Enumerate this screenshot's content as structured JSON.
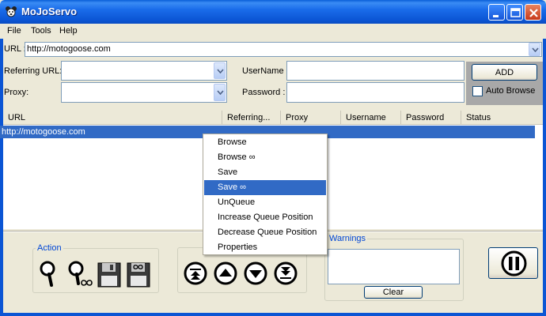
{
  "window": {
    "title": "MoJoServo"
  },
  "menu": [
    "File",
    "Tools",
    "Help"
  ],
  "url_field": {
    "label": "URL :",
    "value": "http://motogoose.com"
  },
  "referring_url": {
    "label": "Referring URL:",
    "value": ""
  },
  "proxy": {
    "label": "Proxy:",
    "value": ""
  },
  "username": {
    "label": "UserName :",
    "value": ""
  },
  "password": {
    "label": "Password :",
    "value": ""
  },
  "add_button": "ADD",
  "auto_browse": {
    "label": "Auto Browse",
    "checked": false
  },
  "table": {
    "columns": [
      "URL",
      "Referring...",
      "Proxy",
      "Username",
      "Password",
      "Status"
    ],
    "rows": [
      {
        "url": "http://motogoose.com",
        "referring": "",
        "proxy": "",
        "username": "",
        "password": "",
        "status": "",
        "selected": true
      }
    ]
  },
  "context_menu": {
    "items": [
      "Browse",
      "Browse ∞",
      "Save",
      "Save ∞",
      "UnQueue",
      "Increase Queue Position",
      "Decrease Queue Position",
      "Properties"
    ],
    "highlighted": "Save ∞"
  },
  "action_group": {
    "title": "Action",
    "buttons": [
      {
        "icon": "magnifier-icon"
      },
      {
        "icon": "magnifier-infinity-icon"
      },
      {
        "icon": "floppy-disk-icon"
      },
      {
        "icon": "floppy-disk-infinity-icon"
      }
    ]
  },
  "queue_group": {
    "buttons": [
      {
        "icon": "move-top-icon"
      },
      {
        "icon": "move-up-icon"
      },
      {
        "icon": "move-down-icon"
      },
      {
        "icon": "move-bottom-icon"
      }
    ]
  },
  "warnings": {
    "title": "Warnings",
    "text": "",
    "clear_button": "Clear"
  },
  "pause_button": {
    "icon": "pause-icon"
  },
  "colors": {
    "titlebar": "#0b55d4",
    "selection": "#316ac5",
    "window_bg": "#ece9d8",
    "group_title": "#0046d5"
  }
}
